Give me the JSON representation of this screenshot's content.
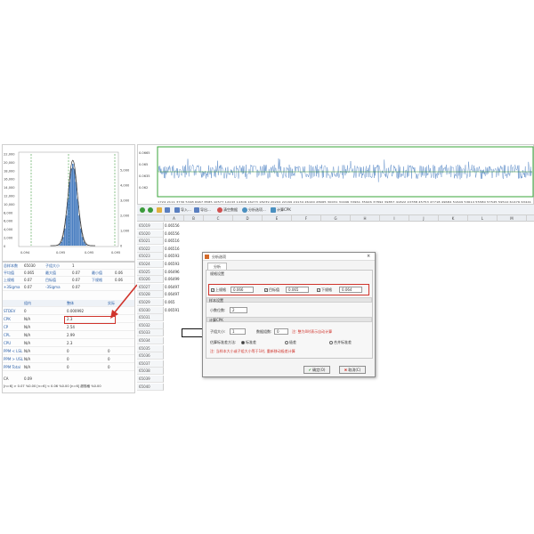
{
  "colors": {
    "accent": "#4a7fc1",
    "highlight": "#d0342c",
    "trend_frame": "#3aa63a"
  },
  "histogram": {
    "left_axis": [
      "22,000",
      "20,000",
      "18,000",
      "16,000",
      "14,000",
      "12,000",
      "10,000",
      "8,000",
      "6,000",
      "4,000",
      "2,000",
      "0"
    ],
    "right_axis": [
      "5,000",
      "4,000",
      "3,000",
      "2,000",
      "1,000",
      "0"
    ],
    "x_ticks": [
      "0.094",
      "0.095",
      "0.095",
      "0.095"
    ]
  },
  "stats": {
    "summary_rows": [
      [
        "总样本数",
        "65030",
        "子组大小",
        "1",
        "",
        ""
      ],
      [
        "平均值",
        "0.065",
        "最大值",
        "0.07",
        "最小值",
        "0.06"
      ],
      [
        "上规格",
        "0.07",
        "目标值",
        "0.07",
        "下规格",
        "0.06"
      ],
      [
        "+3Sigma",
        "0.07",
        "-3Sigma",
        "0.07",
        "",
        ""
      ]
    ],
    "table_header": [
      "",
      "组内",
      "整体",
      "实际"
    ],
    "table_rows": [
      [
        "STDEV",
        "0",
        "0.000992",
        ""
      ],
      [
        "CPK",
        "N/A",
        "2.3",
        ""
      ],
      [
        "CP",
        "N/A",
        "2.54",
        ""
      ],
      [
        "CPL",
        "N/A",
        "2.99",
        ""
      ],
      [
        "CPU",
        "N/A",
        "2.3",
        ""
      ],
      [
        "PPM < LSL",
        "N/A",
        "0",
        "0"
      ],
      [
        "PPM > USL",
        "N/A",
        "0",
        "0"
      ],
      [
        "PPM Total",
        "N/A",
        "0",
        "0"
      ]
    ],
    "ca_label": "CA",
    "ca_value": "0.09",
    "footer": "[n=6] > 0.07 %0.00   [n=6] < 0.06 %0.00   [n=6] 超规格 %0.00"
  },
  "trend": {
    "y_ticks": [
      "0.0665",
      "0.065",
      "0.0635",
      "0.062"
    ],
    "x_ticks": "1724 2111 3730 5348 6967 8585 10577 12243 14306 16273 18239 20204 22169 24134 26100 28065 30031 31996 33961 35926 37892 39857 41822 43788 45753 47718 49684 51649 53614 55580 57545 59510 61476 63441"
  },
  "toolbar": {
    "items": [
      "导入...",
      "导出...",
      "清空数据",
      "分析选项...",
      "计算CPK"
    ]
  },
  "sheet": {
    "columns": [
      "A",
      "B",
      "C",
      "D",
      "E",
      "F",
      "G",
      "H",
      "I",
      "J",
      "K",
      "L",
      "M"
    ],
    "rows": [
      [
        "65019",
        "0.06556"
      ],
      [
        "65020",
        "0.06556"
      ],
      [
        "65021",
        "0.06516"
      ],
      [
        "65022",
        "0.06516"
      ],
      [
        "65023",
        "0.06593"
      ],
      [
        "65024",
        "0.06593"
      ],
      [
        "65025",
        "0.06496"
      ],
      [
        "65026",
        "0.06499"
      ],
      [
        "65027",
        "0.06497"
      ],
      [
        "65028",
        "0.06497"
      ],
      [
        "65029",
        "0.065"
      ],
      [
        "65030",
        "0.06591"
      ],
      [
        "65031",
        ""
      ],
      [
        "65032",
        ""
      ],
      [
        "65033",
        ""
      ],
      [
        "65034",
        ""
      ],
      [
        "65035",
        ""
      ],
      [
        "65036",
        ""
      ],
      [
        "65037",
        ""
      ],
      [
        "65038",
        ""
      ],
      [
        "65039",
        ""
      ],
      [
        "65040",
        ""
      ]
    ]
  },
  "dialog": {
    "title": "分析选项",
    "tab": "分析",
    "spec_section": "规格设置",
    "usl_label": "上规格",
    "usl_value": "0.066",
    "target_label": "目标值",
    "target_value": "0.065",
    "lsl_label": "下规格",
    "lsl_value": "0.064",
    "sample_section": "样本设置",
    "decimals_label": "小数位数:",
    "decimals_value": "2",
    "cpk_section": "计算CPK",
    "subgroup_label": "子组大小:",
    "subgroup_value": "1",
    "sets_label": "数据组数:",
    "sets_value": "0",
    "sets_note": "注: 整为0时表示自动计算",
    "method_label": "估算标准差方法:",
    "method_options": [
      "标准差",
      "极差",
      "合并标准差"
    ],
    "note": "注: 当样本大小或子组大小等于1时, 重新移动极差计算",
    "ok_label": "确定(O)",
    "cancel_label": "取消(C)"
  }
}
